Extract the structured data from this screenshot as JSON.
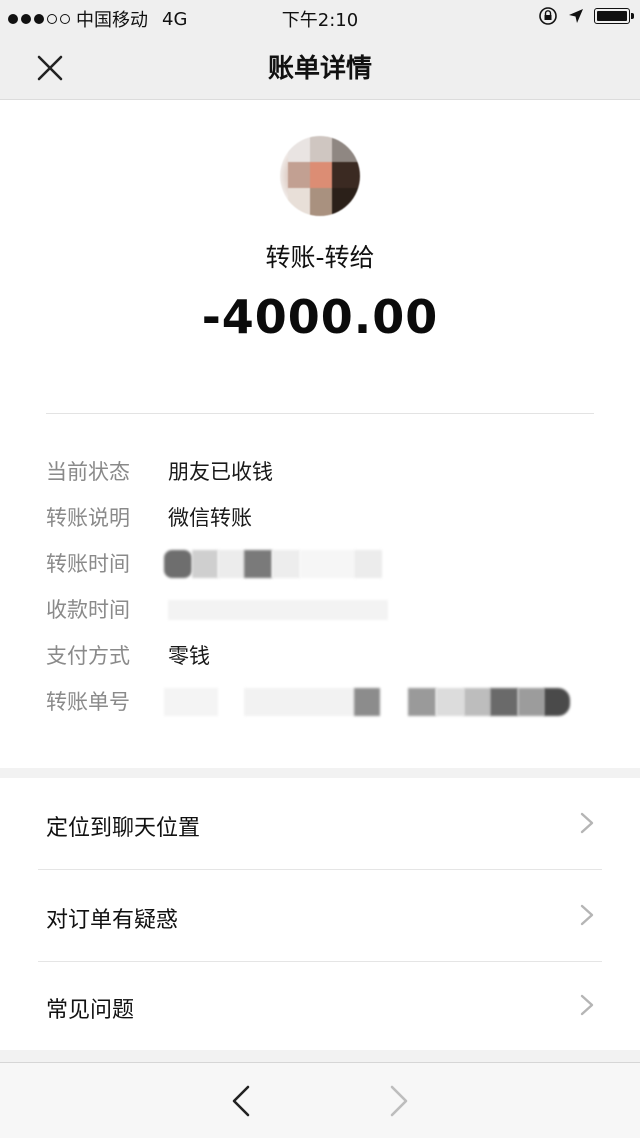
{
  "status_bar": {
    "carrier": "中国移动",
    "network": "4G",
    "time": "下午2:10",
    "signal_bars": 3,
    "signal_total": 5
  },
  "nav": {
    "title": "账单详情",
    "close_icon": "close-icon"
  },
  "transaction": {
    "title": "转账-转给",
    "amount": "-4000.00",
    "details": [
      {
        "label": "当前状态",
        "value": "朋友已收钱"
      },
      {
        "label": "转账说明",
        "value": "微信转账"
      },
      {
        "label": "转账时间",
        "value": ""
      },
      {
        "label": "收款时间",
        "value": ""
      },
      {
        "label": "支付方式",
        "value": "零钱"
      },
      {
        "label": "转账单号",
        "value": ""
      }
    ]
  },
  "actions": [
    {
      "label": "定位到聊天位置",
      "icon": "chevron-right-icon"
    },
    {
      "label": "对订单有疑惑",
      "icon": "chevron-right-icon"
    },
    {
      "label": "常见问题",
      "icon": "chevron-right-icon"
    }
  ],
  "toolbar": {
    "back_icon": "chevron-left-icon",
    "forward_icon": "chevron-right-icon"
  },
  "colors": {
    "background": "#f2f2f2",
    "card": "#ffffff",
    "label_gray": "#8a8a8a",
    "text": "#1a1a1a"
  }
}
